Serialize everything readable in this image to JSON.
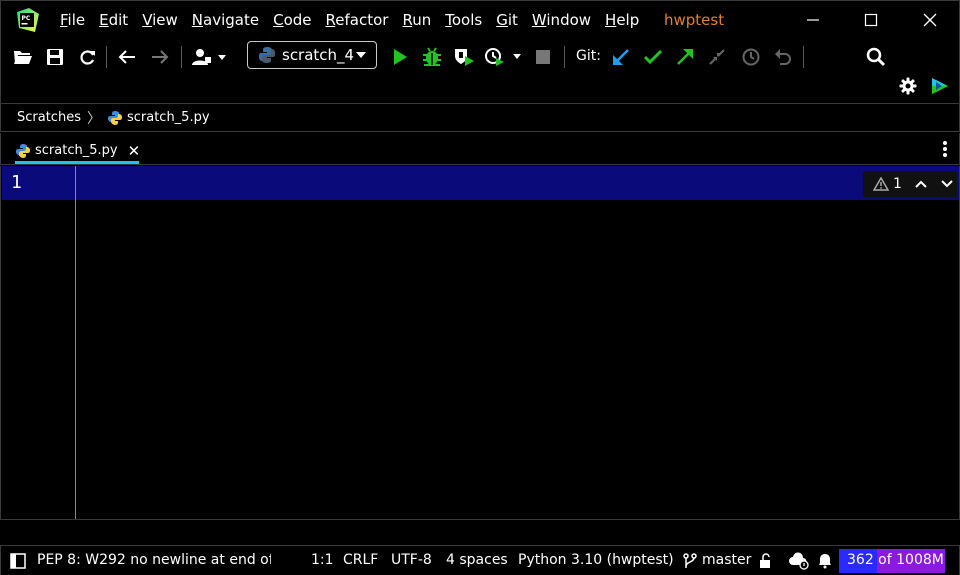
{
  "window": {
    "project_title": "hwptest",
    "app_icon": "pycharm-logo-icon"
  },
  "menu": [
    {
      "key": "F",
      "rest": "ile"
    },
    {
      "key": "E",
      "rest": "dit"
    },
    {
      "key": "V",
      "rest": "iew"
    },
    {
      "key": "N",
      "rest": "avigate"
    },
    {
      "key": "C",
      "rest": "ode"
    },
    {
      "key": "R",
      "rest": "efactor"
    },
    {
      "key": "R",
      "rest": "un"
    },
    {
      "key": "T",
      "rest": "ools"
    },
    {
      "key": "G",
      "rest": "it"
    },
    {
      "key": "W",
      "rest": "indow"
    },
    {
      "key": "H",
      "rest": "elp"
    }
  ],
  "toolbar": {
    "run_config": "scratch_4",
    "git_label": "Git:"
  },
  "breadcrumb": {
    "root": "Scratches",
    "file": "scratch_5.py"
  },
  "tabs": [
    {
      "label": "scratch_5.py",
      "active": true
    }
  ],
  "editor": {
    "line_numbers": [
      "1"
    ],
    "inspection_count": "1"
  },
  "status": {
    "message": "PEP 8: W292 no newline at end of",
    "position": "1:1",
    "line_sep": "CRLF",
    "encoding": "UTF-8",
    "indent": "4 spaces",
    "interpreter": "Python 3.10 (hwptest)",
    "branch": "master",
    "memory_used": "362",
    "memory_text": " of 1008M",
    "memory_fraction": 0.36
  },
  "colors": {
    "accent": "#1fc5e8",
    "current_line": "#0a0a7a",
    "project_title": "#e0802e",
    "run_green": "#22c322",
    "git_update": "#1f9ff0",
    "memory_total": "#8a1ae0",
    "memory_used": "#2a2aff"
  }
}
